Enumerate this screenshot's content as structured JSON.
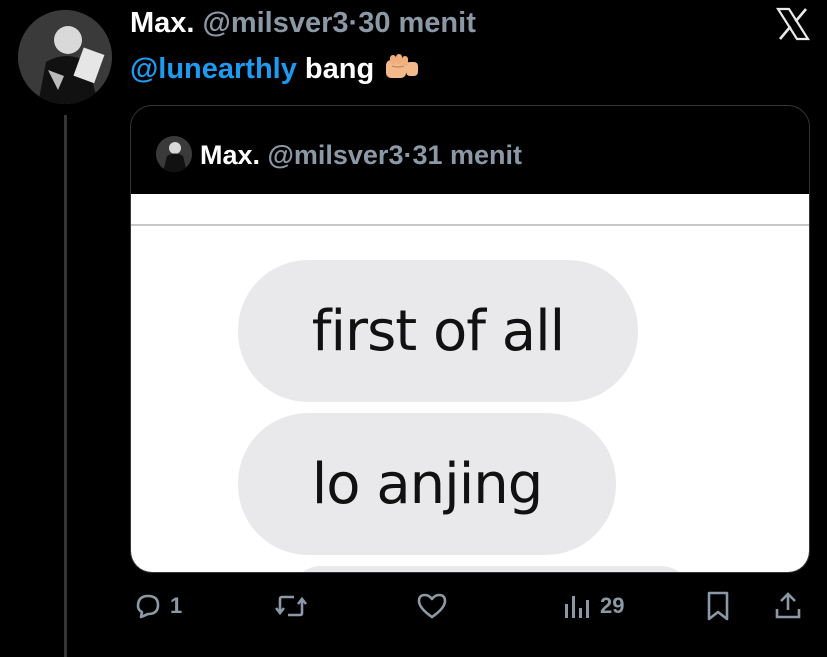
{
  "tweet": {
    "display_name": "Max.",
    "handle": "@milsver3",
    "separator": "·",
    "time": "30 menit",
    "mention": "@lunearthly",
    "body": " bang"
  },
  "quoted": {
    "display_name": "Max.",
    "handle": "@milsver3",
    "separator": "·",
    "time": "31 menit",
    "bubbles": [
      "first of all",
      "lo anjing",
      ""
    ]
  },
  "actions": {
    "reply_count": "1",
    "retweet_count": "",
    "like_count": "",
    "views_count": "29"
  },
  "icons": [
    "x-logo-icon",
    "fist-emoji-icon",
    "reply-icon",
    "retweet-icon",
    "like-icon",
    "views-icon",
    "bookmark-icon",
    "share-icon"
  ],
  "colors": {
    "background": "#000000",
    "link": "#1d9bf0",
    "muted": "#8b98a5",
    "bubble": "#e9e9eb"
  }
}
